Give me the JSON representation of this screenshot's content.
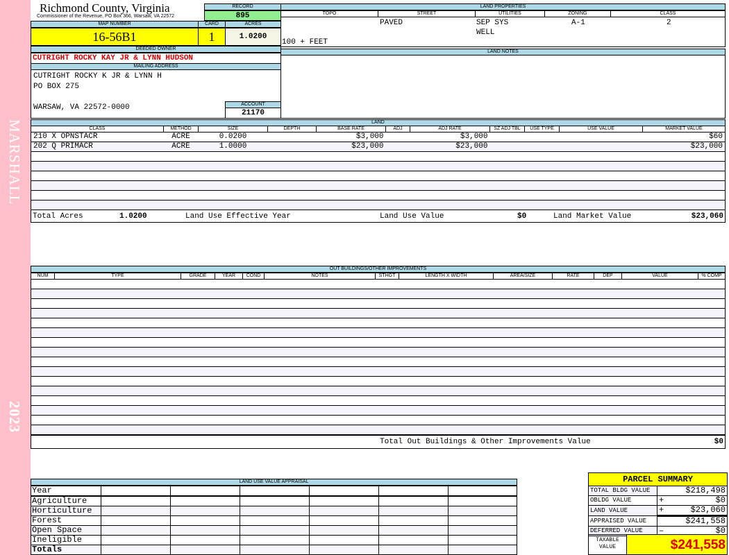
{
  "sidebar": {
    "district": "MARSHALL",
    "year": "2023"
  },
  "header": {
    "county": "Richmond County, Virginia",
    "subtitle": "Commissioner of the Revenue, PO Box 366, Warsaw, VA 22572"
  },
  "record": {
    "label": "RECORD",
    "value": "895"
  },
  "map": {
    "label": "MAP NUMBER",
    "value": "16-56B1"
  },
  "card": {
    "label": "CARD",
    "value": "1"
  },
  "acres": {
    "label": "ACRES",
    "value": "1.0200"
  },
  "owner": {
    "label": "DEEDED OWNER",
    "value": "CUTRIGHT ROCKY KAY JR & LYNN HUDSON"
  },
  "mailing": {
    "label": "MAILING ADDRESS",
    "lines": [
      "CUTRIGHT ROCKY K JR & LYNN H",
      "PO BOX 275",
      "",
      "WARSAW, VA 22572-0000"
    ]
  },
  "account": {
    "label": "ACCOUNT",
    "value": "21170"
  },
  "land_properties": {
    "label": "LAND PROPERTIES",
    "topo_label": "TOPO",
    "street_label": "STREET",
    "utilities_label": "UTILITIES",
    "zoning_label": "ZONING",
    "class_label": "CLASS",
    "street": "PAVED",
    "utilities_1": "SEP SYS",
    "utilities_2": "WELL",
    "zoning": "A-1",
    "class": "2",
    "topo": "100 + FEET"
  },
  "land_notes": {
    "label": "LAND NOTES"
  },
  "land": {
    "label": "LAND",
    "columns": [
      "CLASS",
      "METHOD",
      "SIZE",
      "DEPTH",
      "BASE RATE",
      "ADJ",
      "ADJ RATE",
      "SZ ADJ TBL",
      "USE TYPE",
      "USE VALUE",
      "MARKET VALUE"
    ],
    "rows": [
      [
        "210 X OPNSTACR",
        "ACRE",
        "0.0200",
        "",
        "$3,000",
        "",
        "$3,000",
        "",
        "",
        "",
        "$60"
      ],
      [
        "202 Q PRIMACR",
        "ACRE",
        "1.0000",
        "",
        "$23,000",
        "",
        "$23,000",
        "",
        "",
        "",
        "$23,000"
      ]
    ],
    "totals": {
      "acres_label": "Total Acres",
      "acres": "1.0200",
      "effective_year_label": "Land Use Effective Year",
      "effective_year": "",
      "use_value_label": "Land Use Value",
      "use_value": "$0",
      "market_label": "Land Market Value",
      "market": "$23,060"
    }
  },
  "outbuildings": {
    "label": "OUT BUILDINGS/OTHER IMPROVEMENTS",
    "columns": [
      "NUM",
      "TYPE",
      "GRADE",
      "YEAR",
      "COND",
      "NOTES",
      "STHGT",
      "LENGTH X WIDTH",
      "AREA/SIZE",
      "RATE",
      "DEP",
      "VALUE",
      "% COMP"
    ],
    "total_label": "Total Out Buildings & Other Improvements Value",
    "total": "$0"
  },
  "land_use": {
    "label": "LAND USE VALUE APPRAISAL",
    "year_label": "Year",
    "rows": [
      "Agriculture",
      "Horticulture",
      "Forest",
      "Open Space",
      "Ineligible"
    ],
    "totals_label": "Totals"
  },
  "parcel_summary": {
    "title": "PARCEL SUMMARY",
    "total_bldg_label": "TOTAL BLDG VALUE",
    "total_bldg": "$218,498",
    "obldg_label": "OBLDG VALUE",
    "obldg": "$0",
    "land_label": "LAND VALUE",
    "land": "$23,060",
    "appraised_label": "APPRAISED VALUE",
    "appraised": "$241,558",
    "deferred_label": "DEFERRED VALUE",
    "deferred": "$0",
    "taxable_label": "TAXABLE VALUE",
    "taxable": "$241,558",
    "plus": "+",
    "minus": "–"
  },
  "colors": {
    "sidebar": "#ffc0cb",
    "header": "#add8e6",
    "highlight": "#ffff00",
    "record": "#90ee90",
    "owner": "#e00000"
  }
}
